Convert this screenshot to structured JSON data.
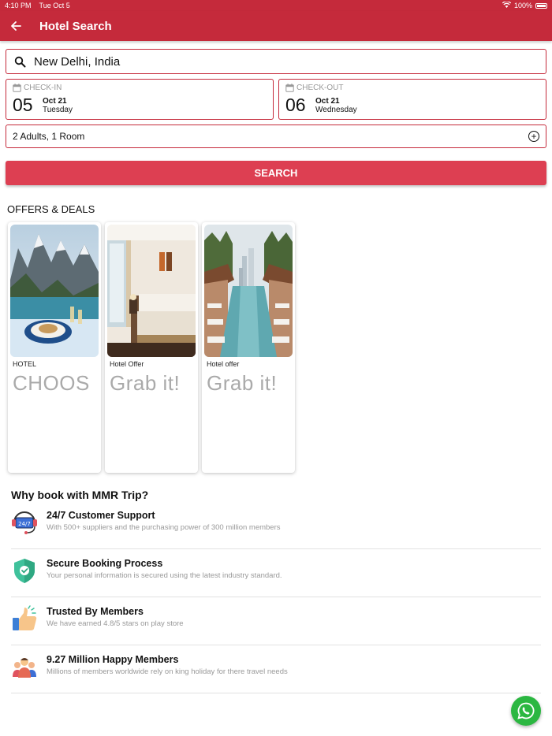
{
  "status_bar": {
    "time": "4:10 PM",
    "date": "Tue Oct 5",
    "battery": "100%"
  },
  "header": {
    "title": "Hotel Search"
  },
  "search": {
    "location": "New Delhi, India"
  },
  "check_in": {
    "label": "CHECK-IN",
    "day": "05",
    "month": "Oct 21",
    "weekday": "Tuesday"
  },
  "check_out": {
    "label": "CHECK-OUT",
    "day": "06",
    "month": "Oct 21",
    "weekday": "Wednesday"
  },
  "guests": {
    "value": "2 Adults, 1 Room"
  },
  "search_button": {
    "label": "SEARCH"
  },
  "offers": {
    "title": "OFFERS & DEALS",
    "cards": [
      {
        "tag": "HOTEL",
        "headline": "CHOOS"
      },
      {
        "tag": "Hotel Offer",
        "headline": "Grab it!"
      },
      {
        "tag": "Hotel offer",
        "headline": "Grab it!"
      }
    ]
  },
  "why": {
    "title": "Why book with MMR Trip?",
    "features": [
      {
        "icon": "support-icon",
        "title": "24/7 Customer Support",
        "desc": "With 500+ suppliers and the purchasing power of 300 million members"
      },
      {
        "icon": "shield-check-icon",
        "title": "Secure Booking Process",
        "desc": "Your personal information is secured using the latest industry standard."
      },
      {
        "icon": "thumbs-up-icon",
        "title": "Trusted By Members",
        "desc": "We have earned 4.8/5 stars on play store"
      },
      {
        "icon": "people-icon",
        "title": "9.27 Million Happy Members",
        "desc": "Millions of members worldwide rely on king holiday for there travel needs"
      }
    ],
    "support_icon_text": "24/7"
  },
  "colors": {
    "brand": "#c52a3b",
    "button": "#dd3f52",
    "whatsapp": "#2bb741"
  }
}
